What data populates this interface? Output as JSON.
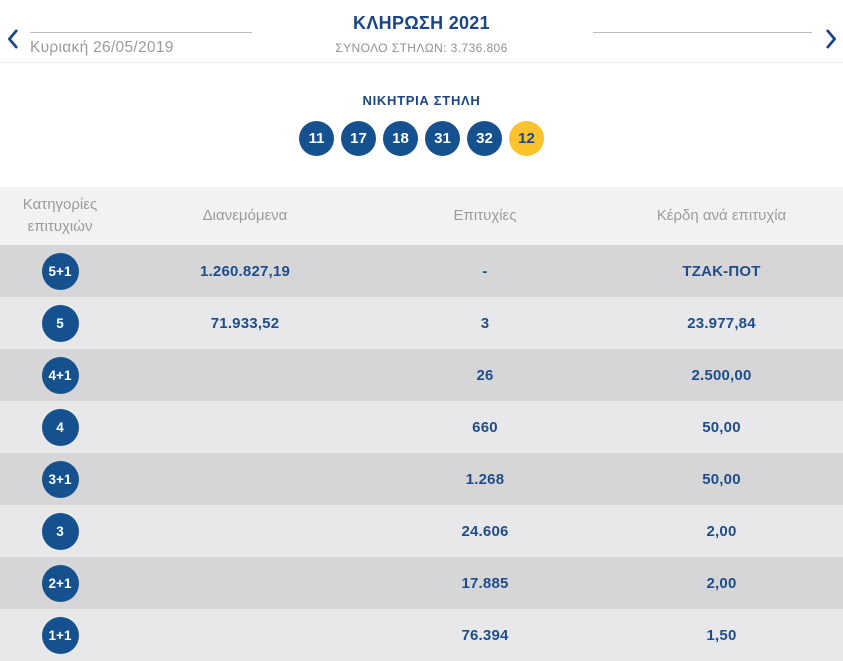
{
  "colors": {
    "primary_blue": "#15508f",
    "text_blue": "#1a4586",
    "joker_yellow": "#fcc32d",
    "row_light": "#e8e8ea",
    "row_dark": "#d6d6d8",
    "table_header_band": "#f3f2f1",
    "muted_gray_text": "#9b9b9b"
  },
  "header": {
    "title": "ΚΛΗΡΩΣΗ 2021",
    "total_columns": "ΣΥΝΟΛΟ ΣΤΗΛΩΝ: 3.736.806",
    "date": "Κυριακή 26/05/2019",
    "prev_icon": "chevron-left",
    "next_icon": "chevron-right"
  },
  "winning_column": {
    "title": "ΝΙΚΗΤΡΙΑ ΣΤΗΛΗ",
    "numbers": [
      "11",
      "17",
      "18",
      "31",
      "32"
    ],
    "joker_number": "12"
  },
  "results_table": {
    "headers": [
      "Κατηγορίες επιτυχιών",
      "Διανεμόμενα",
      "Επιτυχίες",
      "Κέρδη ανά επιτυχία"
    ],
    "rows": [
      {
        "category": "5+1",
        "distributed": "1.260.827,19",
        "winners": "-",
        "prize_per_winner": "ΤΖΑΚ-ΠΟΤ"
      },
      {
        "category": "5",
        "distributed": "71.933,52",
        "winners": "3",
        "prize_per_winner": "23.977,84"
      },
      {
        "category": "4+1",
        "distributed": "",
        "winners": "26",
        "prize_per_winner": "2.500,00"
      },
      {
        "category": "4",
        "distributed": "",
        "winners": "660",
        "prize_per_winner": "50,00"
      },
      {
        "category": "3+1",
        "distributed": "",
        "winners": "1.268",
        "prize_per_winner": "50,00"
      },
      {
        "category": "3",
        "distributed": "",
        "winners": "24.606",
        "prize_per_winner": "2,00"
      },
      {
        "category": "2+1",
        "distributed": "",
        "winners": "17.885",
        "prize_per_winner": "2,00"
      },
      {
        "category": "1+1",
        "distributed": "",
        "winners": "76.394",
        "prize_per_winner": "1,50"
      }
    ]
  }
}
